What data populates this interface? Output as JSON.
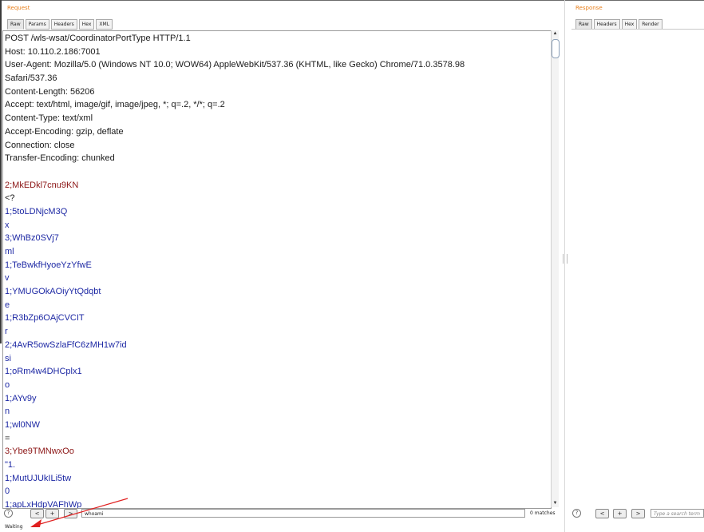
{
  "request": {
    "title": "Request",
    "tabs": [
      "Raw",
      "Params",
      "Headers",
      "Hex",
      "XML"
    ],
    "lines": [
      {
        "text": "POST /wls-wsat/CoordinatorPortType HTTP/1.1",
        "kind": "req"
      },
      {
        "text": "Host: 10.110.2.186:7001",
        "kind": "req"
      },
      {
        "text": "User-Agent: Mozilla/5.0 (Windows NT 10.0; WOW64) AppleWebKit/537.36 (KHTML, like Gecko) Chrome/71.0.3578.98",
        "kind": "req"
      },
      {
        "text": "Safari/537.36",
        "kind": "req"
      },
      {
        "text": "Content-Length: 56206",
        "kind": "req"
      },
      {
        "text": "Accept: text/html, image/gif, image/jpeg, *; q=.2, */*; q=.2",
        "kind": "req"
      },
      {
        "text": "Content-Type: text/xml",
        "kind": "req"
      },
      {
        "text": "Accept-Encoding: gzip, deflate",
        "kind": "req"
      },
      {
        "text": "Connection: close",
        "kind": "req"
      },
      {
        "text": "Transfer-Encoding: chunked",
        "kind": "req"
      },
      {
        "text": "",
        "kind": "req"
      },
      {
        "text": "2;MkEDkl7cnu9KN",
        "kind": "red"
      },
      {
        "text": "<?",
        "kind": "req"
      },
      {
        "text": "1;5toLDNjcM3Q",
        "kind": "blue"
      },
      {
        "text": "x",
        "kind": "blue"
      },
      {
        "text": "3;WhBz0SVj7",
        "kind": "blue"
      },
      {
        "text": "ml",
        "kind": "blue"
      },
      {
        "text": "1;TeBwkfHyoeYzYfwE",
        "kind": "blue"
      },
      {
        "text": "v",
        "kind": "blue"
      },
      {
        "text": "1;YMUGOkAOiyYtQdqbt",
        "kind": "blue"
      },
      {
        "text": "e",
        "kind": "blue"
      },
      {
        "text": "1;R3bZp6OAjCVCIT",
        "kind": "blue"
      },
      {
        "text": "r",
        "kind": "blue"
      },
      {
        "text": "2;4AvR5owSzlaFfC6zMH1w7id",
        "kind": "blue"
      },
      {
        "text": "si",
        "kind": "blue"
      },
      {
        "text": "1;oRm4w4DHCplx1",
        "kind": "blue"
      },
      {
        "text": "o",
        "kind": "blue"
      },
      {
        "text": "1;AYv9y",
        "kind": "blue"
      },
      {
        "text": "n",
        "kind": "blue"
      },
      {
        "text": "1;wl0NW",
        "kind": "blue"
      },
      {
        "text": "=",
        "kind": "req"
      },
      {
        "text": "3;Ybe9TMNwxOo",
        "kind": "red"
      },
      {
        "text": "\"1.",
        "kind": "blue"
      },
      {
        "text": "1;MutUJUkILi5tw",
        "kind": "blue"
      },
      {
        "text": "0",
        "kind": "blue"
      },
      {
        "text": "1;apLxHdpVAFhWp",
        "kind": "blue"
      }
    ],
    "search": {
      "help": "?",
      "prev": "<",
      "add": "+",
      "next": ">",
      "value": "whoami",
      "matches": "0 matches"
    }
  },
  "response": {
    "title": "Response",
    "tabs": [
      "Raw",
      "Headers",
      "Hex",
      "Render"
    ],
    "search": {
      "help": "?",
      "prev": "<",
      "add": "+",
      "next": ">",
      "placeholder": "Type a search term"
    }
  },
  "status": {
    "text": "Waiting"
  },
  "icons": {
    "scroll_up": "triangle-up",
    "scroll_down": "triangle-down",
    "annotation": "red-arrow"
  },
  "colors": {
    "section_title": "#e8801d",
    "red_chunk": "#8b1414",
    "blue_chunk": "#1d28a4",
    "annotation_arrow": "#e02020"
  }
}
